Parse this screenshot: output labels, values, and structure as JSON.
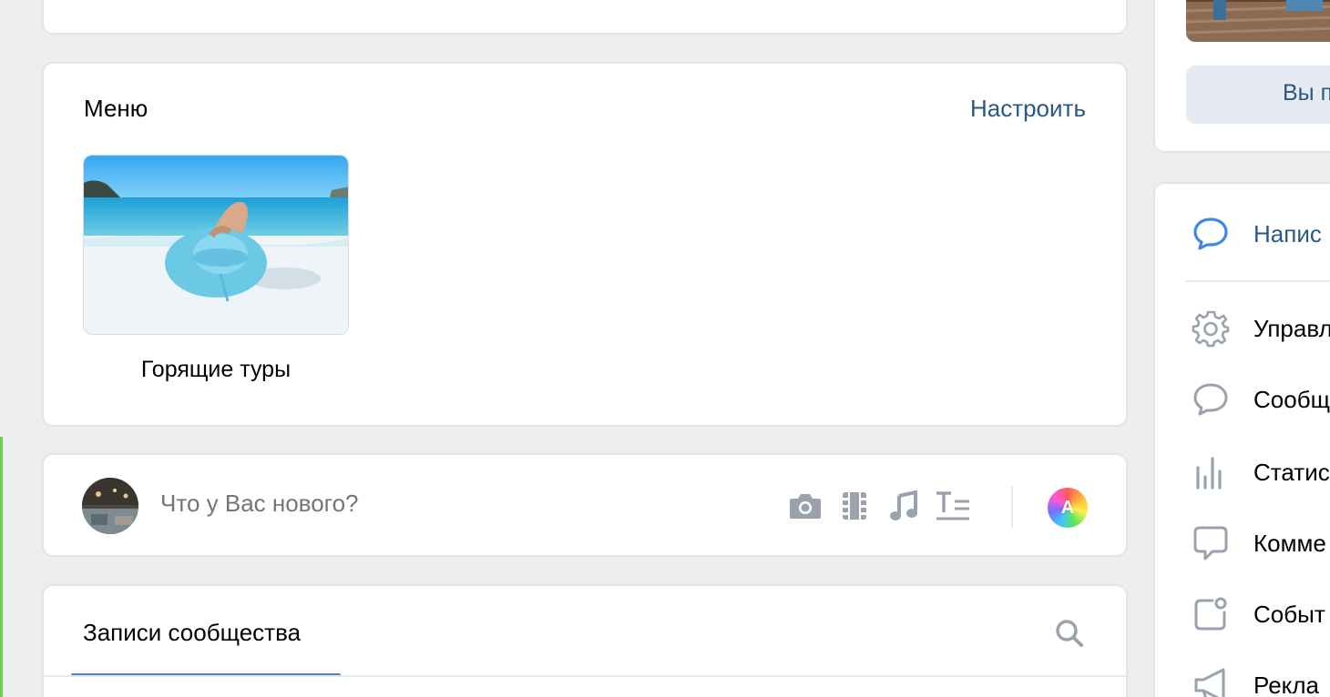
{
  "menu": {
    "title": "Меню",
    "configure_label": "Настроить",
    "items": [
      {
        "label": "Горящие туры"
      }
    ]
  },
  "composer": {
    "placeholder": "Что у Вас нового?",
    "tools": [
      "camera-icon",
      "video-icon",
      "music-icon",
      "text-icon"
    ],
    "ai_badge": "A"
  },
  "posts": {
    "tab_label": "Записи сообщества"
  },
  "right_top": {
    "button_label": "Вы п"
  },
  "right_menu": {
    "items": [
      {
        "label": "Напис",
        "icon": "message-bubble-icon"
      },
      {
        "label": "Управл",
        "icon": "gear-icon"
      },
      {
        "label": "Сообщ",
        "icon": "chat-icon"
      },
      {
        "label": "Статис",
        "icon": "statistics-icon"
      },
      {
        "label": "Комме",
        "icon": "comment-icon"
      },
      {
        "label": "Событ",
        "icon": "event-icon"
      },
      {
        "label": "Рекла",
        "icon": "megaphone-icon"
      }
    ]
  },
  "colors": {
    "link": "#2a5885",
    "accent": "#5181b8",
    "background": "#edeef0",
    "icon_gray": "#99a2ad"
  }
}
